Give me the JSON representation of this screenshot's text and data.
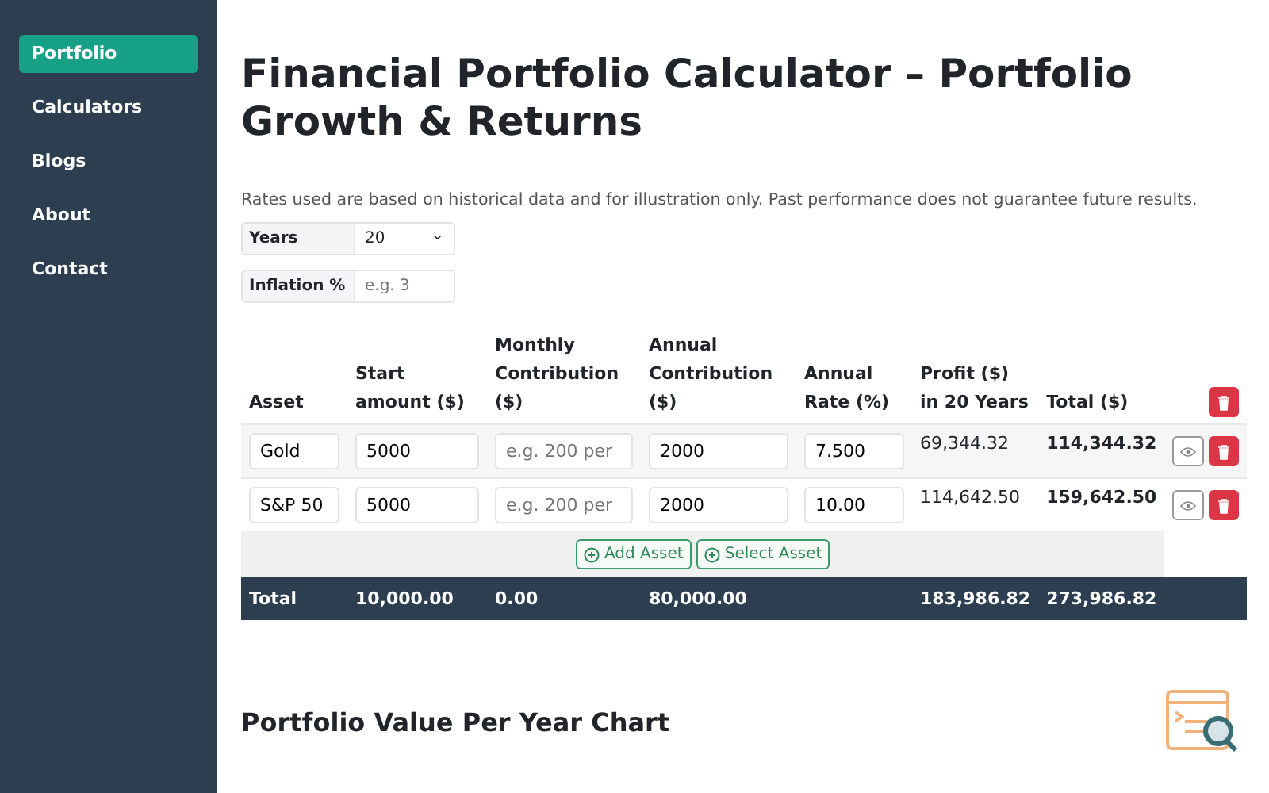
{
  "sidebar": {
    "items": [
      {
        "label": "Portfolio",
        "selected": true
      },
      {
        "label": "Calculators",
        "selected": false
      },
      {
        "label": "Blogs",
        "selected": false
      },
      {
        "label": "About",
        "selected": false
      },
      {
        "label": "Contact",
        "selected": false
      }
    ]
  },
  "title": "Financial Portfolio Calculator – Portfolio Growth & Returns",
  "note": "Rates used are based on historical data and for illustration only. Past performance does not guarantee future results.",
  "settings": {
    "years": {
      "label": "Years",
      "value": "20",
      "caret": "⌄"
    },
    "inflation": {
      "label": "Inflation %",
      "placeholder": "e.g. 3"
    }
  },
  "table": {
    "columns": [
      "Asset",
      "Start amount ($)",
      "Monthly Contribution ($)",
      "Annual Contribution ($)",
      "Annual Rate (%)",
      "Profit ($) in 20 Years",
      "Total ($)"
    ],
    "rows": [
      {
        "asset": "Gold",
        "start": "5000",
        "monthly_placeholder": "e.g. 200 per",
        "annual": "2000",
        "rate": "7.500",
        "profit": "69,344.32",
        "total": "114,344.32"
      },
      {
        "asset": "S&P 50",
        "start": "5000",
        "monthly_placeholder": "e.g. 200 per",
        "annual": "2000",
        "rate": "10.00",
        "profit": "114,642.50",
        "total": "159,642.50"
      }
    ],
    "actions": [
      "Add Asset",
      "Select Asset"
    ],
    "totals": {
      "label": "Total",
      "start": "10,000.00",
      "monthly": "0.00",
      "annual": "80,000.00",
      "profit": "183,986.82",
      "total": "273,986.82"
    }
  },
  "chart_heading": "Portfolio Value Per Year Chart"
}
